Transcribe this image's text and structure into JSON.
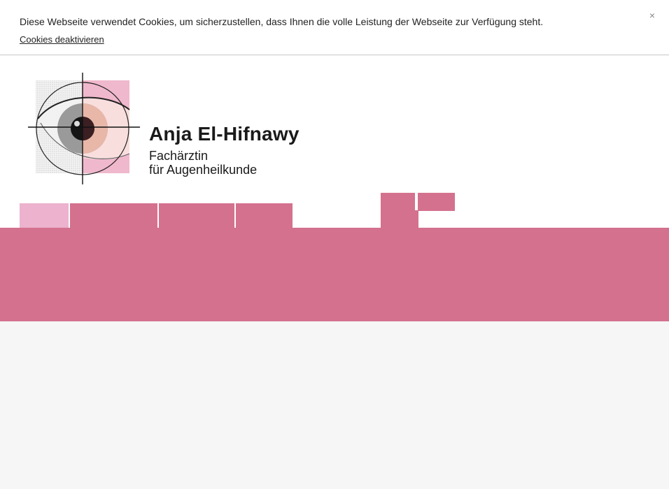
{
  "cookie_bar": {
    "message": "Diese Webseite verwendet Cookies, um sicherzustellen, dass Ihnen die volle Leistung der Webseite zur Verfügung steht.",
    "disable_link": "Cookies deaktivieren",
    "close_label": "×"
  },
  "brand": {
    "name": "Anja El-Hifnawy",
    "subtitle_line1": "Fachärztin",
    "subtitle_line2": "für Augenheilkunde"
  },
  "colors": {
    "accent": "#d4718e",
    "accent_light": "#ecb2ce",
    "page_background": "#f6f6f6"
  }
}
